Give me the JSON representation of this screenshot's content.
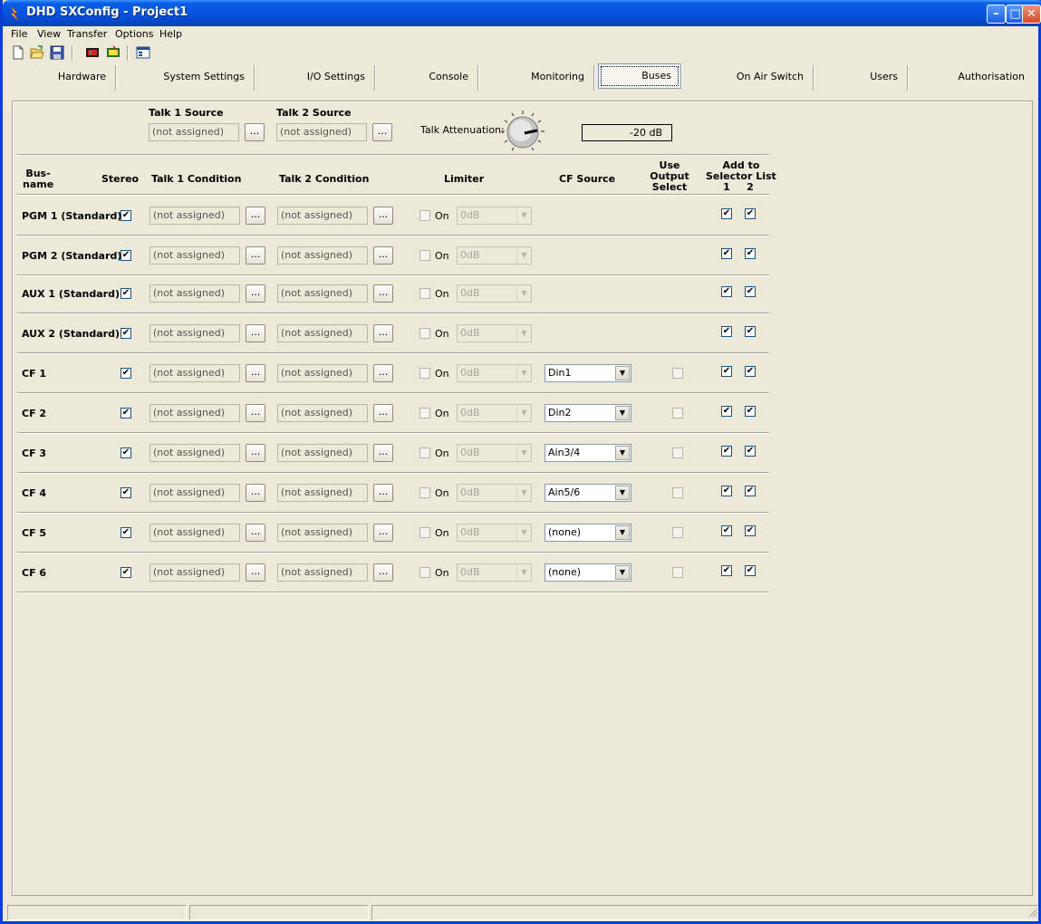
{
  "window": {
    "title": "DHD SXConfig - Project1"
  },
  "menu": [
    "File",
    "View",
    "Transfer",
    "Options",
    "Help"
  ],
  "toolbar": [
    "new-icon",
    "open-icon",
    "save-icon",
    "device-red-icon",
    "device-yellow-icon",
    "config-icon"
  ],
  "tabs": [
    {
      "label": "Hardware"
    },
    {
      "label": "System Settings"
    },
    {
      "label": "I/O Settings"
    },
    {
      "label": "Console"
    },
    {
      "label": "Monitoring"
    },
    {
      "label": "Buses",
      "active": true
    },
    {
      "label": "On Air Switch"
    },
    {
      "label": "Users"
    },
    {
      "label": "Authorisation"
    }
  ],
  "talk": {
    "talk1_source_label": "Talk 1 Source",
    "talk1_source_value": "(not assigned)",
    "talk2_source_label": "Talk 2 Source",
    "talk2_source_value": "(not assigned)",
    "attenuation_label": "Talk Attenuation:",
    "attenuation_value": "-20 dB",
    "browse_label": "..."
  },
  "headers": {
    "busname_1": "Bus-",
    "busname_2": "name",
    "stereo": "Stereo",
    "talk1_condition": "Talk 1 Condition",
    "talk2_condition": "Talk 2 Condition",
    "limiter": "Limiter",
    "cf_source": "CF Source",
    "use_output_1": "Use",
    "use_output_2": "Output",
    "use_output_3": "Select",
    "add_to_1": "Add to",
    "add_to_2": "Selector List",
    "sel_1": "1",
    "sel_2": "2"
  },
  "limiter_on_label": "On",
  "buses": [
    {
      "name": "PGM 1 (Standard)",
      "stereo": true,
      "talk1": "(not assigned)",
      "talk2": "(not assigned)",
      "limiter_on": false,
      "limiter_value": "0dB",
      "cf_source": null,
      "use_output": null,
      "sel1": true,
      "sel2": true
    },
    {
      "name": "PGM 2 (Standard)",
      "stereo": true,
      "talk1": "(not assigned)",
      "talk2": "(not assigned)",
      "limiter_on": false,
      "limiter_value": "0dB",
      "cf_source": null,
      "use_output": null,
      "sel1": true,
      "sel2": true
    },
    {
      "name": "AUX 1 (Standard)",
      "stereo": true,
      "talk1": "(not assigned)",
      "talk2": "(not assigned)",
      "limiter_on": false,
      "limiter_value": "0dB",
      "cf_source": null,
      "use_output": null,
      "sel1": true,
      "sel2": true
    },
    {
      "name": "AUX 2 (Standard)",
      "stereo": true,
      "talk1": "(not assigned)",
      "talk2": "(not assigned)",
      "limiter_on": false,
      "limiter_value": "0dB",
      "cf_source": null,
      "use_output": null,
      "sel1": true,
      "sel2": true
    },
    {
      "name": "CF 1",
      "stereo": true,
      "talk1": "(not assigned)",
      "talk2": "(not assigned)",
      "limiter_on": false,
      "limiter_value": "0dB",
      "cf_source": "Din1",
      "use_output": false,
      "sel1": true,
      "sel2": true
    },
    {
      "name": "CF 2",
      "stereo": true,
      "talk1": "(not assigned)",
      "talk2": "(not assigned)",
      "limiter_on": false,
      "limiter_value": "0dB",
      "cf_source": "Din2",
      "use_output": false,
      "sel1": true,
      "sel2": true
    },
    {
      "name": "CF 3",
      "stereo": true,
      "talk1": "(not assigned)",
      "talk2": "(not assigned)",
      "limiter_on": false,
      "limiter_value": "0dB",
      "cf_source": "Ain3/4",
      "use_output": false,
      "sel1": true,
      "sel2": true
    },
    {
      "name": "CF 4",
      "stereo": true,
      "talk1": "(not assigned)",
      "talk2": "(not assigned)",
      "limiter_on": false,
      "limiter_value": "0dB",
      "cf_source": "Ain5/6",
      "use_output": false,
      "sel1": true,
      "sel2": true
    },
    {
      "name": "CF 5",
      "stereo": true,
      "talk1": "(not assigned)",
      "talk2": "(not assigned)",
      "limiter_on": false,
      "limiter_value": "0dB",
      "cf_source": "(none)",
      "use_output": false,
      "sel1": true,
      "sel2": true
    },
    {
      "name": "CF 6",
      "stereo": true,
      "talk1": "(not assigned)",
      "talk2": "(not assigned)",
      "limiter_on": false,
      "limiter_value": "0dB",
      "cf_source": "(none)",
      "use_output": false,
      "sel1": true,
      "sel2": true
    }
  ]
}
